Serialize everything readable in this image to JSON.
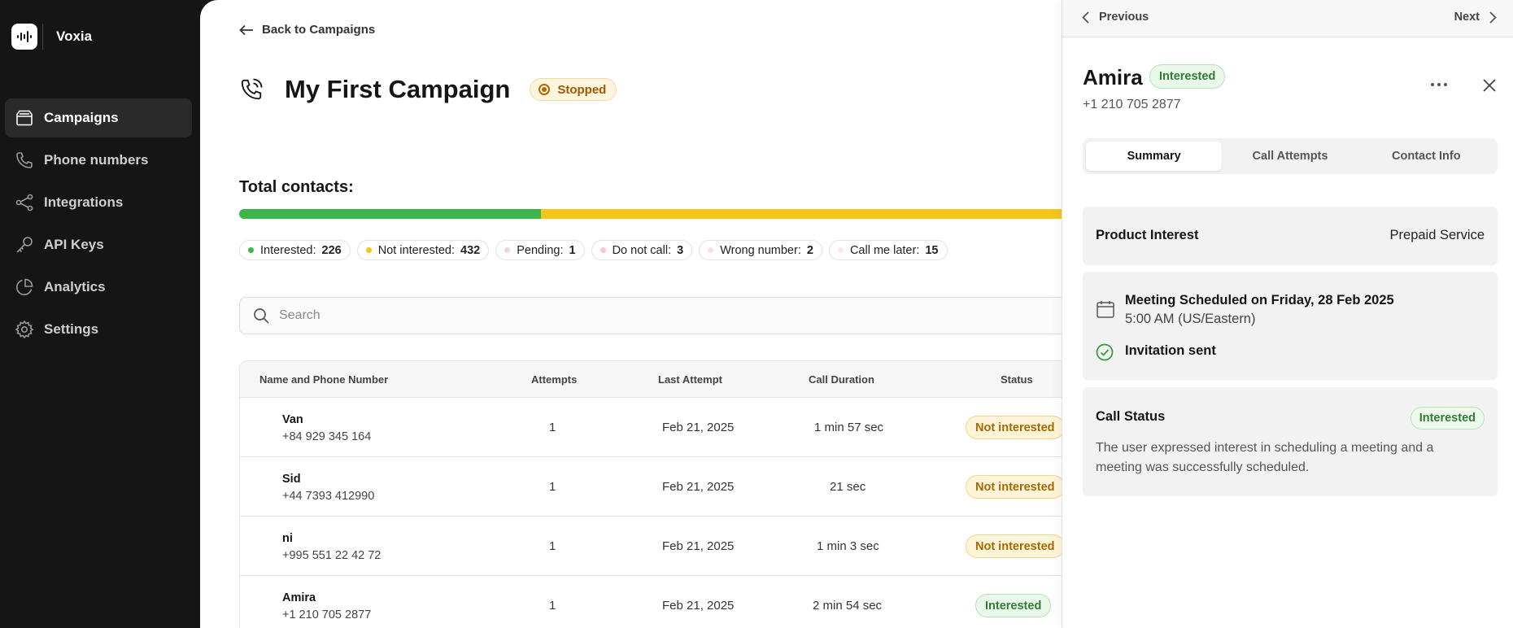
{
  "brand": {
    "name": "Voxia"
  },
  "sidebar": {
    "items": [
      {
        "label": "Campaigns",
        "icon": "folder-icon"
      },
      {
        "label": "Phone numbers",
        "icon": "phone-icon"
      },
      {
        "label": "Integrations",
        "icon": "share-icon"
      },
      {
        "label": "API Keys",
        "icon": "key-icon"
      },
      {
        "label": "Analytics",
        "icon": "pie-chart-icon"
      },
      {
        "label": "Settings",
        "icon": "gear-icon"
      }
    ]
  },
  "main": {
    "back_label": "Back to Campaigns",
    "title": "My First Campaign",
    "status": "Stopped",
    "total_label": "Total contacts:",
    "progress": {
      "interested_count": 226,
      "not_interested_count": 432
    },
    "colors": {
      "green": "#3cb54a",
      "yellow": "#f5c518",
      "stopped": "#b06a00"
    },
    "chips": [
      {
        "label": "Interested:",
        "count": "226",
        "color": "#3cb54a"
      },
      {
        "label": "Not interested:",
        "count": "432",
        "color": "#f5c518"
      },
      {
        "label": "Pending:",
        "count": "1",
        "color": "#f0d5e0"
      },
      {
        "label": "Do not call:",
        "count": "3",
        "color": "#f5c7cf"
      },
      {
        "label": "Wrong number:",
        "count": "2",
        "color": "#f8dde6"
      },
      {
        "label": "Call me later:",
        "count": "15",
        "color": "#fbe8ef"
      }
    ],
    "search_placeholder": "Search"
  },
  "table": {
    "columns": [
      "Name and Phone Number",
      "Attempts",
      "Last Attempt",
      "Call Duration",
      "Status"
    ],
    "rows": [
      {
        "name": "Van",
        "phone": "+84 929 345 164",
        "attempts": "1",
        "last": "Feb 21, 2025",
        "duration": "1 min 57 sec",
        "status": "Not interested"
      },
      {
        "name": "Sid",
        "phone": "+44 7393 412990",
        "attempts": "1",
        "last": "Feb 21, 2025",
        "duration": "21 sec",
        "status": "Not interested"
      },
      {
        "name": "ni",
        "phone": "+995 551 22 42 72",
        "attempts": "1",
        "last": "Feb 21, 2025",
        "duration": "1 min 3 sec",
        "status": "Not interested"
      },
      {
        "name": "Amira",
        "phone": "+1 210 705 2877",
        "attempts": "1",
        "last": "Feb 21, 2025",
        "duration": "2 min 54 sec",
        "status": "Interested"
      }
    ]
  },
  "drawer": {
    "previous": "Previous",
    "next": "Next",
    "name": "Amira",
    "badge": "Interested",
    "phone": "+1 210 705 2877",
    "tabs": [
      "Summary",
      "Call Attempts",
      "Contact Info"
    ],
    "product_interest_label": "Product Interest",
    "product_interest_value": "Prepaid Service",
    "meeting_line": "Meeting Scheduled on Friday, 28 Feb 2025",
    "meeting_time": "5:00 AM (US/Eastern)",
    "invitation": "Invitation sent",
    "call_status_label": "Call Status",
    "call_status_badge": "Interested",
    "call_status_desc": "The user expressed interest in scheduling a meeting and a meeting was successfully scheduled."
  }
}
